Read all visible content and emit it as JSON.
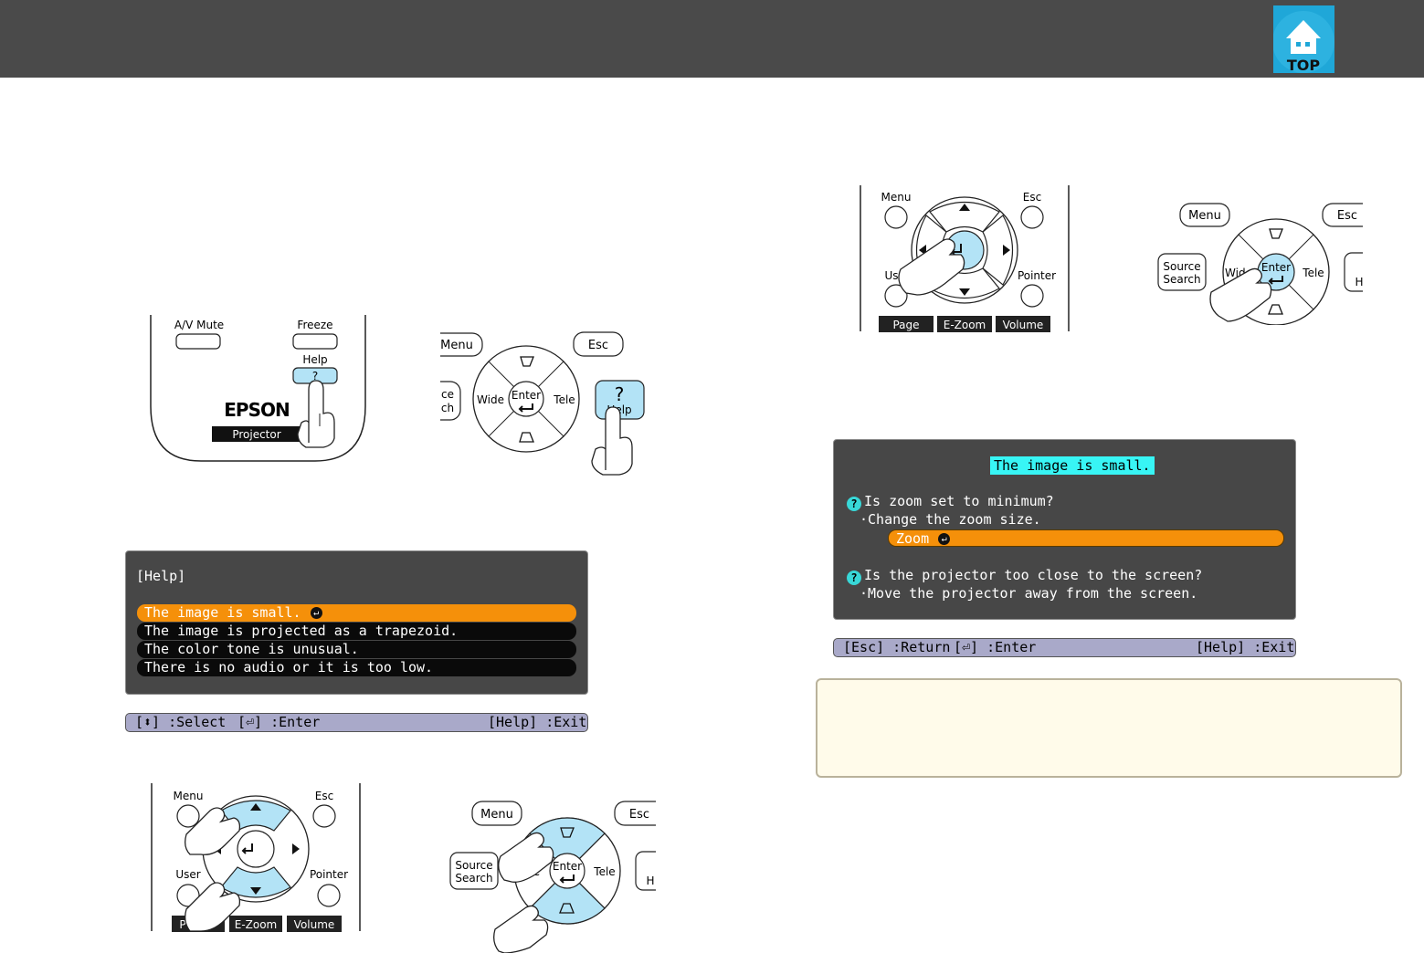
{
  "header": {
    "logo_text": "TOP"
  },
  "remote1": {
    "av_mute": "A/V Mute",
    "freeze": "Freeze",
    "help": "Help",
    "help_symbol": "?",
    "brand": "EPSON",
    "projector": "Projector"
  },
  "panel1": {
    "menu": "Menu",
    "esc": "Esc",
    "source_partial_1": "ce",
    "source_partial_2": "ch",
    "wide": "Wide",
    "enter": "Enter",
    "tele": "Tele",
    "help_symbol": "?",
    "help": "Help"
  },
  "help_menu": {
    "title": "[Help]",
    "items": [
      "The image is small.",
      "The image is projected as a trapezoid.",
      "The color tone is unusual.",
      "There is no audio or it is too low."
    ],
    "guide": {
      "select": "[⬍] :Select",
      "enter": "[⏎] :Enter",
      "exit": "[Help] :Exit"
    }
  },
  "remote2": {
    "menu": "Menu",
    "esc": "Esc",
    "user": "User",
    "pointer": "Pointer",
    "e_zoom": "E-Zoom",
    "volume": "Volume",
    "page_partial": "P"
  },
  "panel2": {
    "menu": "Menu",
    "esc": "Esc",
    "source_1": "Source",
    "source_2": "Search",
    "wide_partial": "ide",
    "enter": "Enter",
    "tele": "Tele",
    "help_partial": "H"
  },
  "remote3": {
    "menu": "Menu",
    "esc": "Esc",
    "user_partial": "Us",
    "pointer": "Pointer",
    "page": "Page",
    "e_zoom": "E-Zoom",
    "volume": "Volume"
  },
  "panel3": {
    "menu": "Menu",
    "esc": "Esc",
    "source_1": "Source",
    "source_2": "Search",
    "wide": "Wide",
    "enter": "Enter",
    "tele": "Tele",
    "help_partial": "H"
  },
  "help_detail": {
    "title": "The image is small.",
    "q1": "Is zoom set to minimum?",
    "a1": "·Change the zoom size.",
    "zoom_button": "Zoom",
    "q2": "Is the projector too close to the screen?",
    "a2": "·Move the projector away from the screen.",
    "guide": {
      "return": "[Esc] :Return",
      "enter": "[⏎] :Enter",
      "exit": "[Help] :Exit"
    }
  },
  "colors": {
    "header_bg": "#4a4a4a",
    "highlight_blue": "#b3e3f6",
    "menu_selected": "#f5900a",
    "title_highlight": "#38f5f5",
    "guide_bar": "#a9a9c9",
    "note_bg": "#fffbea"
  }
}
